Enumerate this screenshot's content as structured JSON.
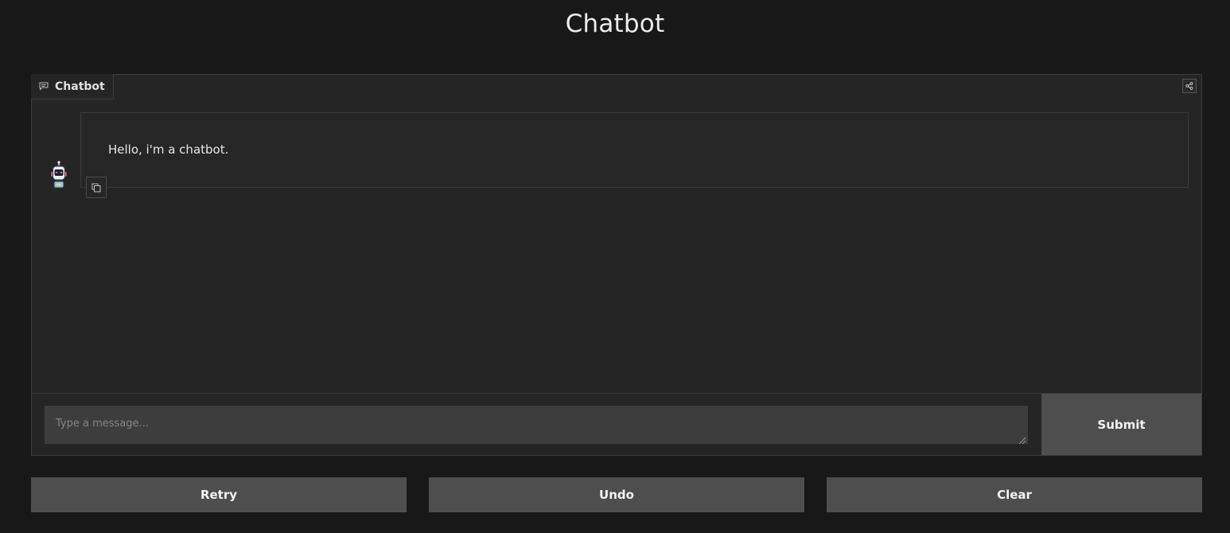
{
  "page": {
    "title": "Chatbot"
  },
  "chat": {
    "label": "Chatbot",
    "label_icon": "chat-bubble-icon",
    "share_icon": "share-icon",
    "avatar_icon": "robot-icon",
    "messages": [
      {
        "role": "bot",
        "text": "Hello, i'm a chatbot.",
        "copy_icon": "copy-icon"
      }
    ]
  },
  "input": {
    "placeholder": "Type a message...",
    "value": "",
    "submit_label": "Submit"
  },
  "actions": {
    "retry_label": "Retry",
    "undo_label": "Undo",
    "clear_label": "Clear"
  },
  "colors": {
    "background": "#181818",
    "panel": "#252525",
    "button": "#4e4e4e",
    "input": "#3d3d3d"
  }
}
